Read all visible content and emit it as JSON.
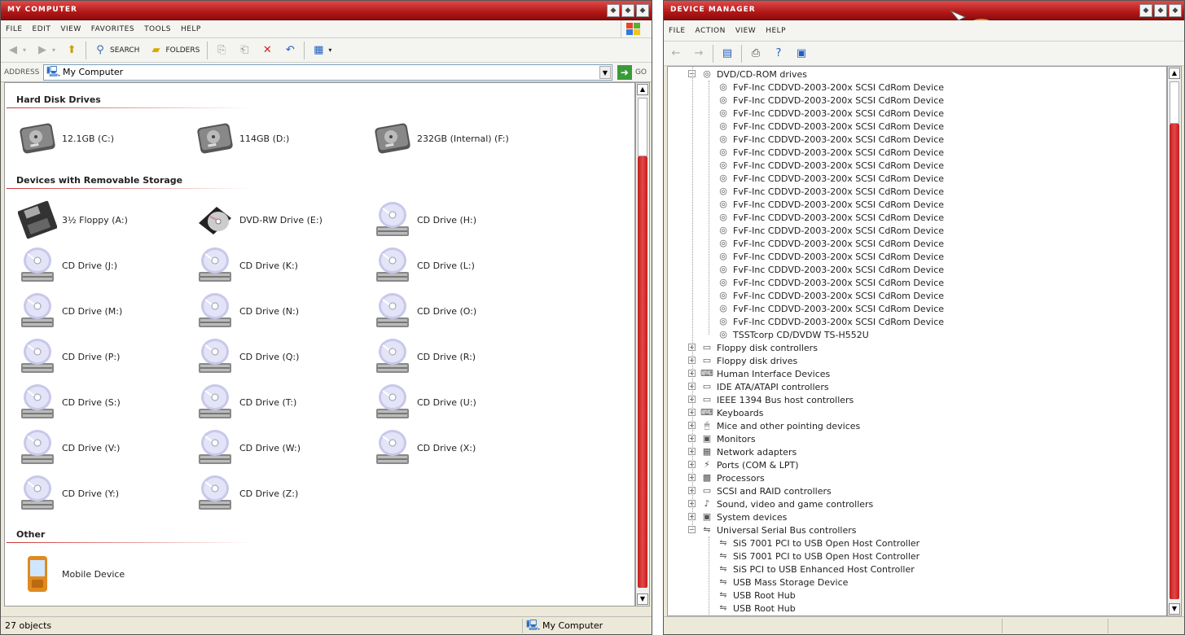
{
  "explorer": {
    "title": "My Computer",
    "menu": [
      "File",
      "Edit",
      "View",
      "Favorites",
      "Tools",
      "Help"
    ],
    "toolbar": {
      "back": "Back",
      "search": "Search",
      "folders": "Folders"
    },
    "address": {
      "label": "Address",
      "value": "My Computer",
      "go": "Go"
    },
    "groups": {
      "hdd": "Hard Disk Drives",
      "removable": "Devices with Removable Storage",
      "other": "Other"
    },
    "hdd": [
      "12.1GB (C:)",
      "114GB (D:)",
      "232GB (Internal) (F:)"
    ],
    "removable": [
      "3½ Floppy (A:)",
      "DVD-RW Drive (E:)",
      "CD Drive (H:)",
      "CD Drive (J:)",
      "CD Drive (K:)",
      "CD Drive (L:)",
      "CD Drive (M:)",
      "CD Drive (N:)",
      "CD Drive (O:)",
      "CD Drive (P:)",
      "CD Drive (Q:)",
      "CD Drive (R:)",
      "CD Drive (S:)",
      "CD Drive (T:)",
      "CD Drive (U:)",
      "CD Drive (V:)",
      "CD Drive (W:)",
      "CD Drive (X:)",
      "CD Drive (Y:)",
      "CD Drive (Z:)"
    ],
    "other": [
      "Mobile Device"
    ],
    "status": {
      "count": "27 objects",
      "location": "My Computer"
    }
  },
  "devmgr": {
    "title": "Device Manager",
    "menu": [
      "File",
      "Action",
      "View",
      "Help"
    ],
    "dvd_category": "DVD/CD-ROM drives",
    "dvd_device": "FvF-Inc CDDVD-2003-200x SCSI CdRom Device",
    "dvd_device_count": 19,
    "dvd_last": "TSSTcorp CD/DVDW TS-H552U",
    "categories": [
      "Floppy disk controllers",
      "Floppy disk drives",
      "Human Interface Devices",
      "IDE ATA/ATAPI controllers",
      "IEEE 1394 Bus host controllers",
      "Keyboards",
      "Mice and other pointing devices",
      "Monitors",
      "Network adapters",
      "Ports (COM & LPT)",
      "Processors",
      "SCSI and RAID controllers",
      "Sound, video and game controllers",
      "System devices"
    ],
    "usb_category": "Universal Serial Bus controllers",
    "usb_devices": [
      "SiS 7001 PCI to USB Open Host Controller",
      "SiS 7001 PCI to USB Open Host Controller",
      "SiS PCI to USB Enhanced Host Controller",
      "USB Mass Storage Device",
      "USB Root Hub",
      "USB Root Hub"
    ]
  },
  "colors": {
    "accent": "#c51b1b",
    "title_bar": "#b11818"
  }
}
